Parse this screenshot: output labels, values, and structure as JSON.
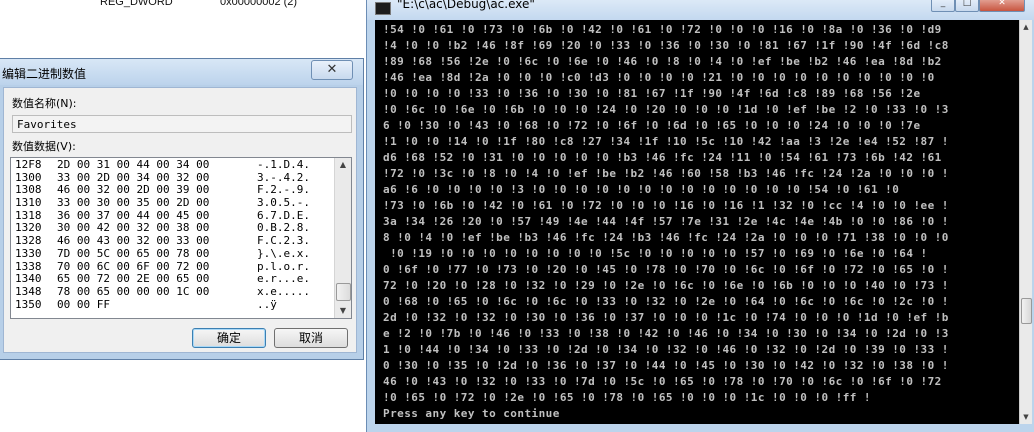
{
  "background": {
    "reg_name": "REG_DWORD",
    "reg_value": "0x00000002 (2)"
  },
  "dialog": {
    "title": "编辑二进制数值",
    "close_glyph": "✕",
    "name_label": "数值名称(N):",
    "name_value": "Favorites",
    "data_label": "数值数据(V):",
    "ok_label": "确定",
    "cancel_label": "取消",
    "rows": [
      {
        "offset": "12F8",
        "bytes": "2D 00 31 00 44 00 34 00",
        "ascii": "-.1.D.4."
      },
      {
        "offset": "1300",
        "bytes": "33 00 2D 00 34 00 32 00",
        "ascii": "3.-.4.2."
      },
      {
        "offset": "1308",
        "bytes": "46 00 32 00 2D 00 39 00",
        "ascii": "F.2.-.9."
      },
      {
        "offset": "1310",
        "bytes": "33 00 30 00 35 00 2D 00",
        "ascii": "3.0.5.-."
      },
      {
        "offset": "1318",
        "bytes": "36 00 37 00 44 00 45 00",
        "ascii": "6.7.D.E."
      },
      {
        "offset": "1320",
        "bytes": "30 00 42 00 32 00 38 00",
        "ascii": "0.B.2.8."
      },
      {
        "offset": "1328",
        "bytes": "46 00 43 00 32 00 33 00",
        "ascii": "F.C.2.3."
      },
      {
        "offset": "1330",
        "bytes": "7D 00 5C 00 65 00 78 00",
        "ascii": "}.\\.e.x."
      },
      {
        "offset": "1338",
        "bytes": "70 00 6C 00 6F 00 72 00",
        "ascii": "p.l.o.r."
      },
      {
        "offset": "1340",
        "bytes": "65 00 72 00 2E 00 65 00",
        "ascii": "e.r...e."
      },
      {
        "offset": "1348",
        "bytes": "78 00 65 00 00 00 1C 00",
        "ascii": "x.e....."
      },
      {
        "offset": "1350",
        "bytes": "00 00 FF",
        "ascii": "..ÿ"
      }
    ]
  },
  "console": {
    "title": "\"E:\\c\\ac\\Debug\\ac.exe\"",
    "lines": [
      "!54 !0 !61 !0 !73 !0 !6b !0 !42 !0 !61 !0 !72 !0 !0 !0 !16 !0 !8a !0 !36 !0 !d9",
      "!4 !0 !0 !b2 !46 !8f !69 !20 !0 !33 !0 !36 !0 !30 !0 !81 !67 !1f !90 !4f !6d !c8",
      "!89 !68 !56 !2e !0 !6c !0 !6e !0 !46 !0 !8 !0 !4 !0 !ef !be !b2 !46 !ea !8d !b2",
      "!46 !ea !8d !2a !0 !0 !0 !c0 !d3 !0 !0 !0 !0 !21 !0 !0 !0 !0 !0 !0 !0 !0 !0 !0",
      "!0 !0 !0 !0 !33 !0 !36 !0 !30 !0 !81 !67 !1f !90 !4f !6d !c8 !89 !68 !56 !2e",
      "!0 !6c !0 !6e !0 !6b !0 !0 !0 !24 !0 !20 !0 !0 !0 !1d !0 !ef !be !2 !0 !33 !0 !3",
      "6 !0 !30 !0 !43 !0 !68 !0 !72 !0 !6f !0 !6d !0 !65 !0 !0 !0 !24 !0 !0 !0 !7e",
      "!1 !0 !0 !14 !0 !1f !80 !c8 !27 !34 !1f !10 !5c !10 !42 !aa !3 !2e !e4 !52 !87 !",
      "d6 !68 !52 !0 !31 !0 !0 !0 !0 !0 !b3 !46 !fc !24 !11 !0 !54 !61 !73 !6b !42 !61",
      "!72 !0 !3c !0 !8 !0 !4 !0 !ef !be !b2 !46 !60 !58 !b3 !46 !fc !24 !2a !0 !0 !0 !",
      "a6 !6 !0 !0 !0 !0 !3 !0 !0 !0 !0 !0 !0 !0 !0 !0 !0 !0 !0 !0 !54 !0 !61 !0",
      "!73 !0 !6b !0 !42 !0 !61 !0 !72 !0 !0 !0 !16 !0 !16 !1 !32 !0 !cc !4 !0 !0 !ee !",
      "3a !34 !26 !20 !0 !57 !49 !4e !44 !4f !57 !7e !31 !2e !4c !4e !4b !0 !0 !86 !0 !",
      "8 !0 !4 !0 !ef !be !b3 !46 !fc !24 !b3 !46 !fc !24 !2a !0 !0 !0 !71 !38 !0 !0 !0",
      " !0 !19 !0 !0 !0 !0 !0 !0 !0 !0 !5c !0 !0 !0 !0 !0 !57 !0 !69 !0 !6e !0 !64 !",
      "0 !6f !0 !77 !0 !73 !0 !20 !0 !45 !0 !78 !0 !70 !0 !6c !0 !6f !0 !72 !0 !65 !0 !",
      "72 !0 !20 !0 !28 !0 !32 !0 !29 !0 !2e !0 !6c !0 !6e !0 !6b !0 !0 !0 !40 !0 !73 !",
      "0 !68 !0 !65 !0 !6c !0 !6c !0 !33 !0 !32 !0 !2e !0 !64 !0 !6c !0 !6c !0 !2c !0 !",
      "2d !0 !32 !0 !32 !0 !30 !0 !36 !0 !37 !0 !0 !0 !1c !0 !74 !0 !0 !0 !1d !0 !ef !b",
      "e !2 !0 !7b !0 !46 !0 !33 !0 !38 !0 !42 !0 !46 !0 !34 !0 !30 !0 !34 !0 !2d !0 !3",
      "1 !0 !44 !0 !34 !0 !33 !0 !2d !0 !34 !0 !32 !0 !46 !0 !32 !0 !2d !0 !39 !0 !33 !",
      "0 !30 !0 !35 !0 !2d !0 !36 !0 !37 !0 !44 !0 !45 !0 !30 !0 !42 !0 !32 !0 !38 !0 !",
      "46 !0 !43 !0 !32 !0 !33 !0 !7d !0 !5c !0 !65 !0 !78 !0 !70 !0 !6c !0 !6f !0 !72",
      "!0 !65 !0 !72 !0 !2e !0 !65 !0 !78 !0 !65 !0 !0 !0 !1c !0 !0 !0 !ff !"
    ],
    "prompt": "Press any key to continue"
  }
}
